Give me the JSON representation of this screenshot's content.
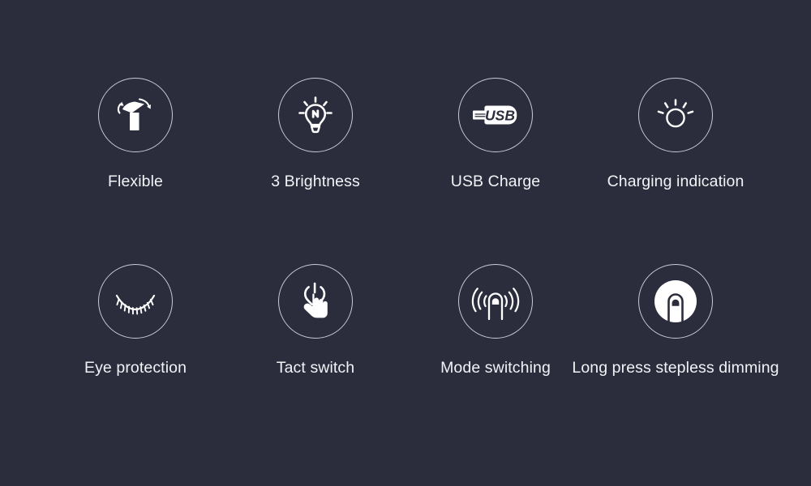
{
  "theme": {
    "background_color": "#2b2d3d",
    "ring_color": "#c9cbd6",
    "icon_color": "#ffffff",
    "label_color": "#f2f3f7"
  },
  "features": {
    "rows": [
      [
        {
          "icon": "flexible-lamp-icon",
          "label": "Flexible"
        },
        {
          "icon": "light-bulb-bolt-icon",
          "label": "3 Brightness"
        },
        {
          "icon": "usb-plug-icon",
          "label": "USB Charge",
          "icon_text": "USB"
        },
        {
          "icon": "sun-brightness-icon",
          "label": "Charging indication"
        }
      ],
      [
        {
          "icon": "closed-eye-lashes-icon",
          "label": "Eye protection"
        },
        {
          "icon": "hand-tap-power-icon",
          "label": "Tact switch"
        },
        {
          "icon": "fingertip-signal-icon",
          "label": "Mode switching"
        },
        {
          "icon": "fingertip-filled-icon",
          "label": "Long press stepless dimming"
        }
      ]
    ]
  }
}
